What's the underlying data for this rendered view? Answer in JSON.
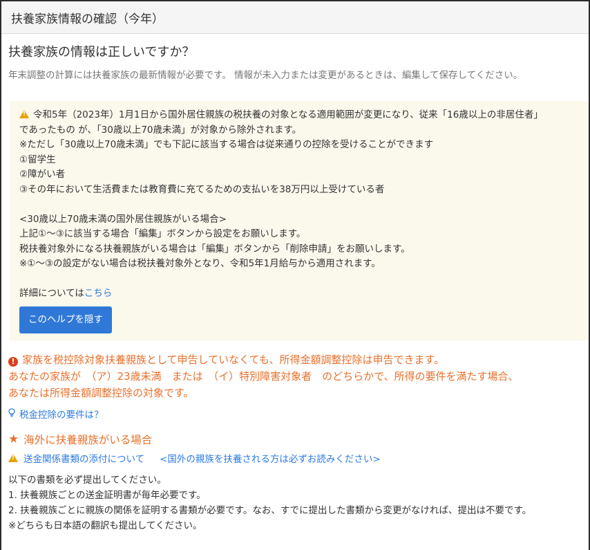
{
  "header": {
    "title": "扶養家族情報の確認（今年）"
  },
  "main": {
    "title": "扶養家族の情報は正しいですか？",
    "intro": "年末調整の計算には扶養家族の最新情報が必要です。 情報が未入力または変更があるときは、編集して保存してください。"
  },
  "help": {
    "line1": "令和5年（2023年）1月1日から国外居住親族の税扶養の対象となる適用範囲が変更になり、従来「16歳以上の非居住者」",
    "line2": "であったもの が、「30歳以上70歳未満」が対象から除外されます。",
    "line3": "※ただし「30歳以上70歳未満」でも下記に該当する場合は従来通りの控除を受けることができます",
    "item1": "①留学生",
    "item2": "②障がい者",
    "item3": "③その年において生活費または教育費に充てるための支払いを38万円以上受けている者",
    "sub_heading": "<30歳以上70歳未満の国外居住親族がいる場合>",
    "sub1": "上記①～③に該当する場合「編集」ボタンから設定をお願いします。",
    "sub2": "税扶養対象外になる扶養親族がいる場合は「編集」ボタンから「削除申請」をお願いします。",
    "sub3": "※①～③の設定がない場合は税扶養対象外となり、令和5年1月給与から適用されます。",
    "details_prefix": "詳細については",
    "details_link": "こちら",
    "hide_button": "このヘルプを隠す"
  },
  "notice": {
    "line1": "家族を税控除対象扶養親族として申告していなくても、所得金額調整控除は申告できます。",
    "line2": "あなたの家族が　（ア）23歳未満　または　（イ）特別障害対象者　のどちらかで、所得の要件を満たす場合、",
    "line3": "あなたは所得金額調整控除の対象です。"
  },
  "tax_requirements_link": "税金控除の要件は？",
  "overseas": {
    "heading": "海外に扶養親族がいる場合",
    "remit_link": "送金関係書類の添付について",
    "must_read_link": "<国外の親族を扶養される方は必ずお読みください>",
    "docs_intro": "以下の書類を必ず提出してください。",
    "doc1": "1. 扶養親族ごとの送金証明書が毎年必要です。",
    "doc2": "2. 扶養親族ごとに親族の関係を証明する書類が必要です。なお、すでに提出した書類から変更がなければ、提出は不要です。",
    "doc3": "※どちらも日本語の翻訳も提出してください。"
  },
  "icons": {
    "warning": "warning-triangle-icon",
    "exclamation": "exclamation-circle-icon",
    "bulb": "lightbulb-icon",
    "star": "star-icon"
  },
  "colors": {
    "accent_orange": "#e8702b",
    "link_blue": "#2c7be5",
    "button_blue": "#2f78d8",
    "warning_yellow": "#e6a100",
    "help_bg": "#fbf8ec"
  }
}
